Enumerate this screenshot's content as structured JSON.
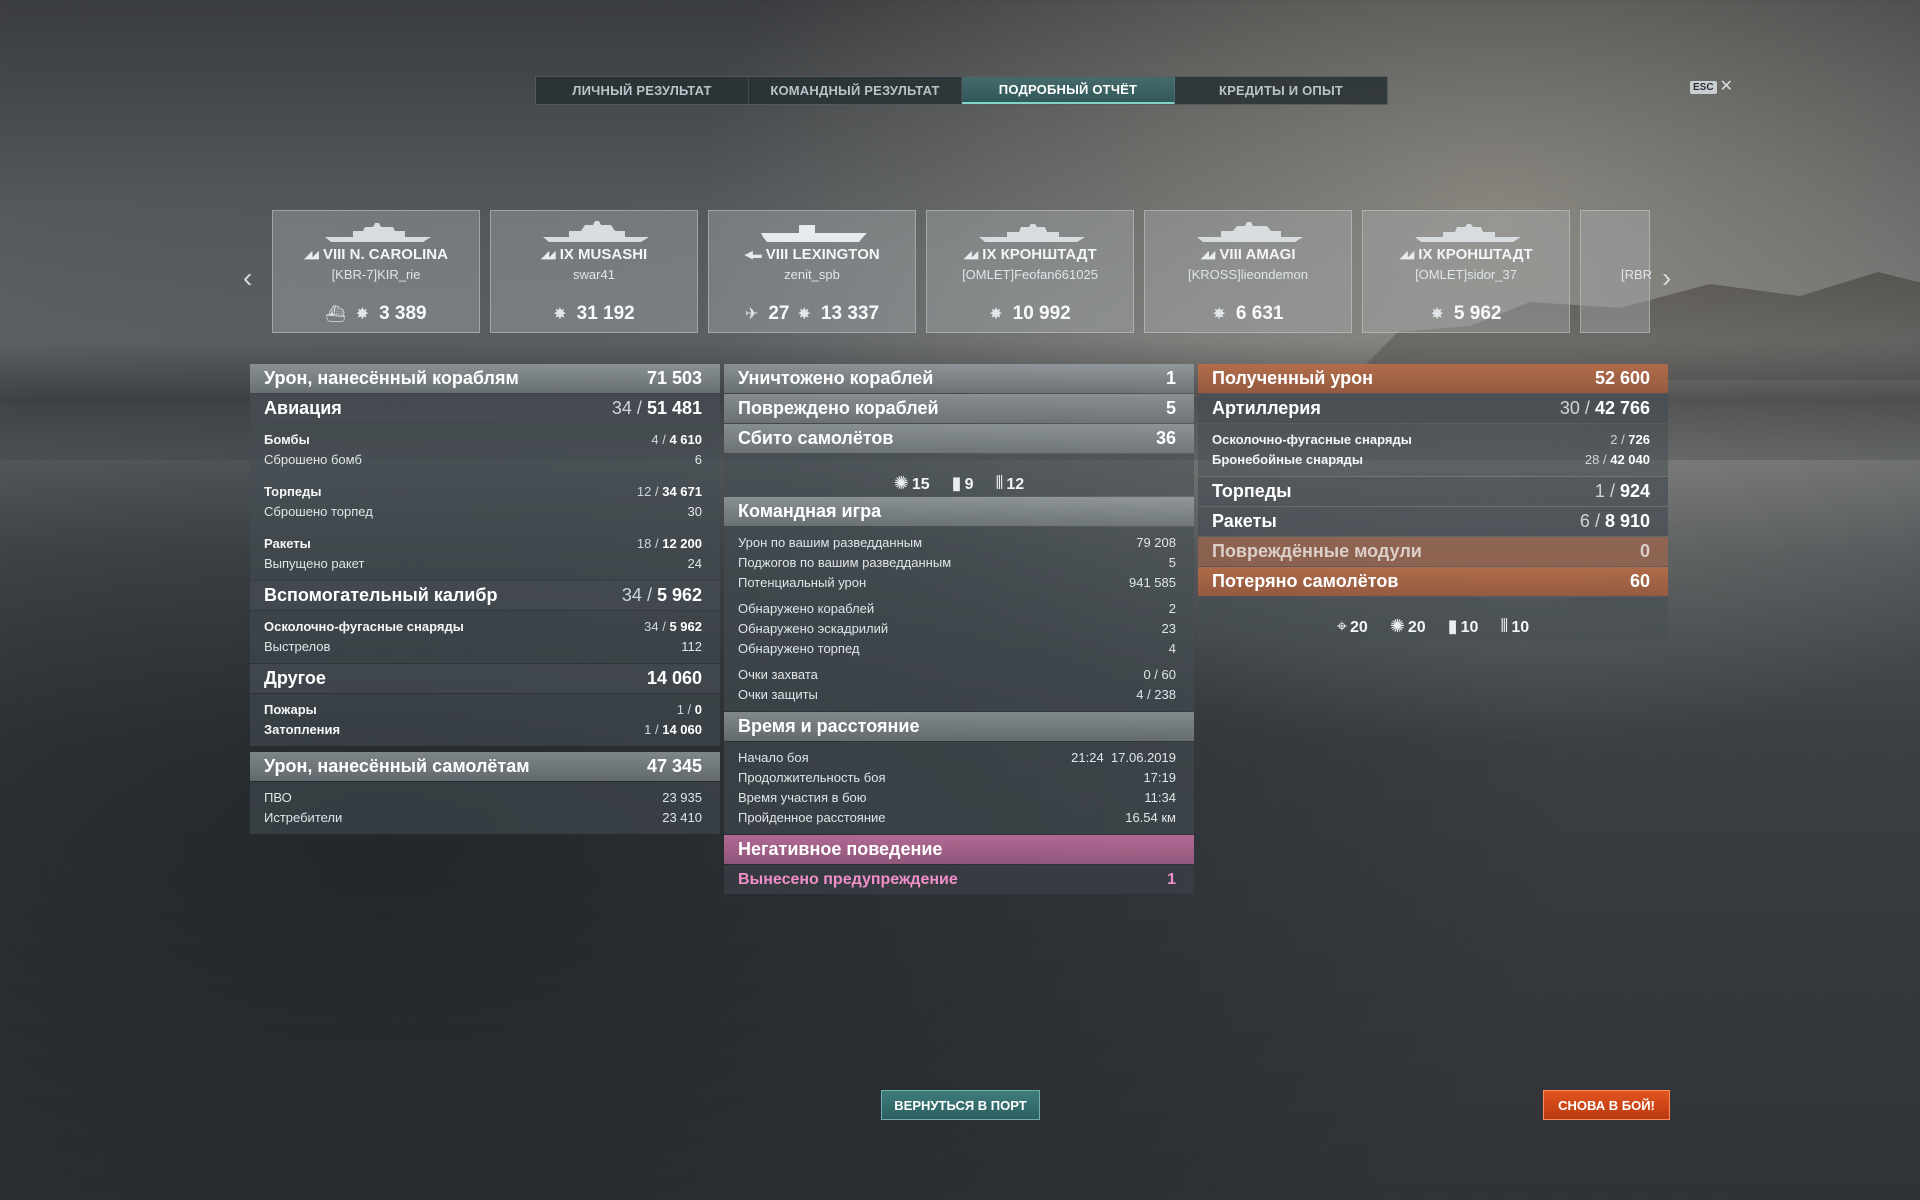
{
  "tabs": [
    {
      "label": "ЛИЧНЫЙ РЕЗУЛЬТАТ"
    },
    {
      "label": "КОМАНДНЫЙ РЕЗУЛЬТАТ"
    },
    {
      "label": "ПОДРОБНЫЙ ОТЧЁТ"
    },
    {
      "label": "КРЕДИТЫ И ОПЫТ"
    }
  ],
  "esc_label": "ESC",
  "ships": [
    {
      "tier_name": "VIII N. CAROLINA",
      "player": "[KBR-7]KIR_rie",
      "damage": "3 389"
    },
    {
      "tier_name": "IX MUSASHI",
      "player": "swar41",
      "damage": "31 192"
    },
    {
      "tier_name": "VIII LEXINGTON",
      "player": "zenit_spb",
      "planes": "27",
      "damage": "13 337"
    },
    {
      "tier_name": "IX КРОНШТАДТ",
      "player": "[OMLET]Feofan661025",
      "damage": "10 992"
    },
    {
      "tier_name": "VIII AMAGI",
      "player": "[KROSS]lieondemon",
      "damage": "6 631"
    },
    {
      "tier_name": "IX КРОНШТАДТ",
      "player": "[OMLET]sidor_37",
      "damage": "5 962"
    },
    {
      "tier_name": "",
      "player": "[RBR",
      "damage": ""
    }
  ],
  "left": {
    "damage_ships": {
      "label": "Урон, нанесённый кораблям",
      "value": "71 503"
    },
    "aviation": {
      "label": "Авиация",
      "hits": "34",
      "value": "51 481"
    },
    "bombs": {
      "label": "Бомбы",
      "hits": "4",
      "value": "4 610"
    },
    "bombs_dropped": {
      "label": "Сброшено бомб",
      "value": "6"
    },
    "torpedoes": {
      "label": "Торпеды",
      "hits": "12",
      "value": "34 671"
    },
    "torpedoes_dropped": {
      "label": "Сброшено торпед",
      "value": "30"
    },
    "rockets": {
      "label": "Ракеты",
      "hits": "18",
      "value": "12 200"
    },
    "rockets_fired": {
      "label": "Выпущено ракет",
      "value": "24"
    },
    "secondary": {
      "label": "Вспомогательный калибр",
      "hits": "34",
      "value": "5 962"
    },
    "he_shells": {
      "label": "Осколочно-фугасные снаряды",
      "hits": "34",
      "value": "5 962"
    },
    "shots": {
      "label": "Выстрелов",
      "value": "112"
    },
    "other": {
      "label": "Другое",
      "value": "14 060"
    },
    "fires": {
      "label": "Пожары",
      "hits": "1",
      "value": "0"
    },
    "floods": {
      "label": "Затопления",
      "hits": "1",
      "value": "14 060"
    },
    "damage_planes": {
      "label": "Урон, нанесённый самолётам",
      "value": "47 345"
    },
    "aa": {
      "label": "ПВО",
      "value": "23 935"
    },
    "fighters": {
      "label": "Истребители",
      "value": "23 410"
    }
  },
  "mid": {
    "destroyed": {
      "label": "Уничтожено кораблей",
      "value": "1"
    },
    "damaged": {
      "label": "Повреждено кораблей",
      "value": "5"
    },
    "planes_down": {
      "label": "Сбито самолётов",
      "value": "36"
    },
    "planes_icons": [
      {
        "icon": "plane-destroyed-icon",
        "value": "15"
      },
      {
        "icon": "bomb-icon",
        "value": "9"
      },
      {
        "icon": "rocket-icon",
        "value": "12"
      }
    ],
    "team": {
      "label": "Командная игра"
    },
    "spot_damage": {
      "label": "Урон по вашим разведданным",
      "value": "79 208"
    },
    "spot_fires": {
      "label": "Поджогов по вашим разведданным",
      "value": "5"
    },
    "potential": {
      "label": "Потенциальный урон",
      "value": "941 585"
    },
    "ships_spotted": {
      "label": "Обнаружено кораблей",
      "value": "2"
    },
    "squads_spotted": {
      "label": "Обнаружено эскадрилий",
      "value": "23"
    },
    "torps_spotted": {
      "label": "Обнаружено торпед",
      "value": "4"
    },
    "capture": {
      "label": "Очки захвата",
      "value": "0 / 60"
    },
    "defense": {
      "label": "Очки защиты",
      "value": "4 / 238"
    },
    "time": {
      "label": "Время и расстояние"
    },
    "start": {
      "label": "Начало боя",
      "value": "21:24  17.06.2019"
    },
    "duration": {
      "label": "Продолжительность боя",
      "value": "17:19"
    },
    "participation": {
      "label": "Время участия в бою",
      "value": "11:34"
    },
    "distance": {
      "label": "Пройденное расстояние",
      "value": "16.54 км"
    },
    "negative": {
      "label": "Негативное поведение"
    },
    "warning": {
      "label": "Вынесено предупреждение",
      "value": "1"
    }
  },
  "right": {
    "received": {
      "label": "Полученный урон",
      "value": "52 600"
    },
    "artillery": {
      "label": "Артиллерия",
      "hits": "30",
      "value": "42 766"
    },
    "he": {
      "label": "Осколочно-фугасные снаряды",
      "hits": "2",
      "value": "726"
    },
    "ap": {
      "label": "Бронебойные снаряды",
      "hits": "28",
      "value": "42 040"
    },
    "torpedoes": {
      "label": "Торпеды",
      "hits": "1",
      "value": "924"
    },
    "rockets": {
      "label": "Ракеты",
      "hits": "6",
      "value": "8 910"
    },
    "modules": {
      "label": "Повреждённые модули",
      "value": "0"
    },
    "planes_lost": {
      "label": "Потеряно самолётов",
      "value": "60"
    },
    "planes_icons": [
      {
        "icon": "crosshair-icon",
        "value": "20"
      },
      {
        "icon": "plane-destroyed-icon",
        "value": "20"
      },
      {
        "icon": "bomb-icon",
        "value": "10"
      },
      {
        "icon": "rocket-icon",
        "value": "10"
      }
    ]
  },
  "buttons": {
    "port": "ВЕРНУТЬСЯ В ПОРТ",
    "battle": "СНОВА В БОЙ!"
  }
}
